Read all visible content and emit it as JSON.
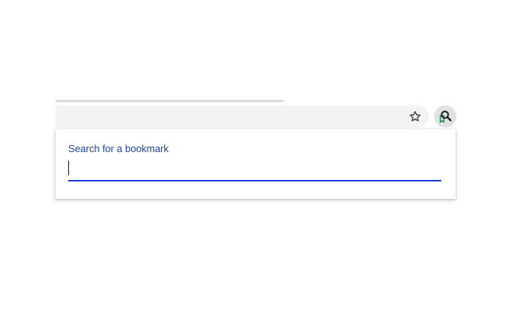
{
  "toolbar": {
    "bookmark_star_icon": "star-outline-icon",
    "extension_icon": "bookmark-search-icon",
    "extension_icon_colors": {
      "magnifier": "#202124",
      "bookmark": "#1e8e3e"
    }
  },
  "popup": {
    "label": "Search for a bookmark",
    "search": {
      "value": "",
      "placeholder": ""
    }
  },
  "colors": {
    "label_text": "#1a47b8",
    "input_underline": "#2340d8",
    "omnibox_background": "#f1f3f4"
  }
}
